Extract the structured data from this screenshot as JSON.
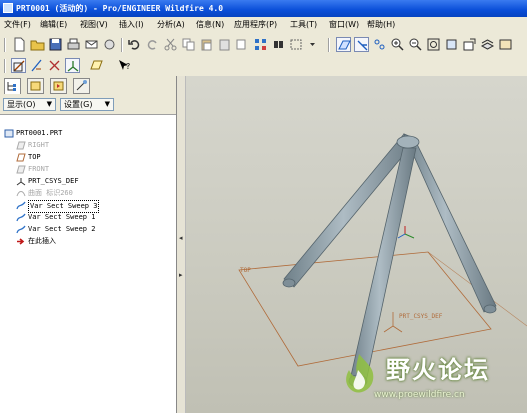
{
  "window": {
    "title": "PRT0001 (活动的) - Pro/ENGINEER Wildfire 4.0"
  },
  "menu": [
    "文件(F)",
    "编辑(E)",
    "视图(V)",
    "插入(I)",
    "分析(A)",
    "信息(N)",
    "应用程序(P)",
    "工具(T)",
    "窗口(W)",
    "帮助(H)"
  ],
  "navigator": {
    "show_dropdown": "显示(O)",
    "settings_dropdown": "设置(G)"
  },
  "model_tree": [
    {
      "label": "PRT0001.PRT",
      "icon": "part-icon",
      "state": "normal"
    },
    {
      "label": "RIGHT",
      "icon": "datum-plane-icon",
      "state": "greyed"
    },
    {
      "label": "TOP",
      "icon": "datum-plane-icon",
      "state": "normal"
    },
    {
      "label": "FRONT",
      "icon": "datum-plane-icon",
      "state": "greyed"
    },
    {
      "label": "PRT_CSYS_DEF",
      "icon": "coordinate-system-icon",
      "state": "normal"
    },
    {
      "label": "曲面 标识260",
      "icon": "surface-icon",
      "state": "greyed"
    },
    {
      "label": "Var Sect Sweep 3",
      "icon": "sweep-icon",
      "state": "selected"
    },
    {
      "label": "Var Sect Sweep 1",
      "icon": "sweep-icon",
      "state": "normal"
    },
    {
      "label": "Var Sect Sweep 2",
      "icon": "sweep-icon",
      "state": "normal"
    },
    {
      "label": "在此插入",
      "icon": "insert-here-arrow-icon",
      "state": "normal"
    }
  ],
  "viewport": {
    "datum_plane_label": "TOP",
    "csys_label": "PRT_CSYS_DEF"
  },
  "watermark": {
    "text": "野火论坛",
    "url": "www.proewildfire.cn"
  },
  "colors": {
    "title_bar": "#0a4ed8",
    "viewport_bg": "#cbcbc0",
    "model": "#8e9ea8",
    "datum": "#b06b3a"
  }
}
